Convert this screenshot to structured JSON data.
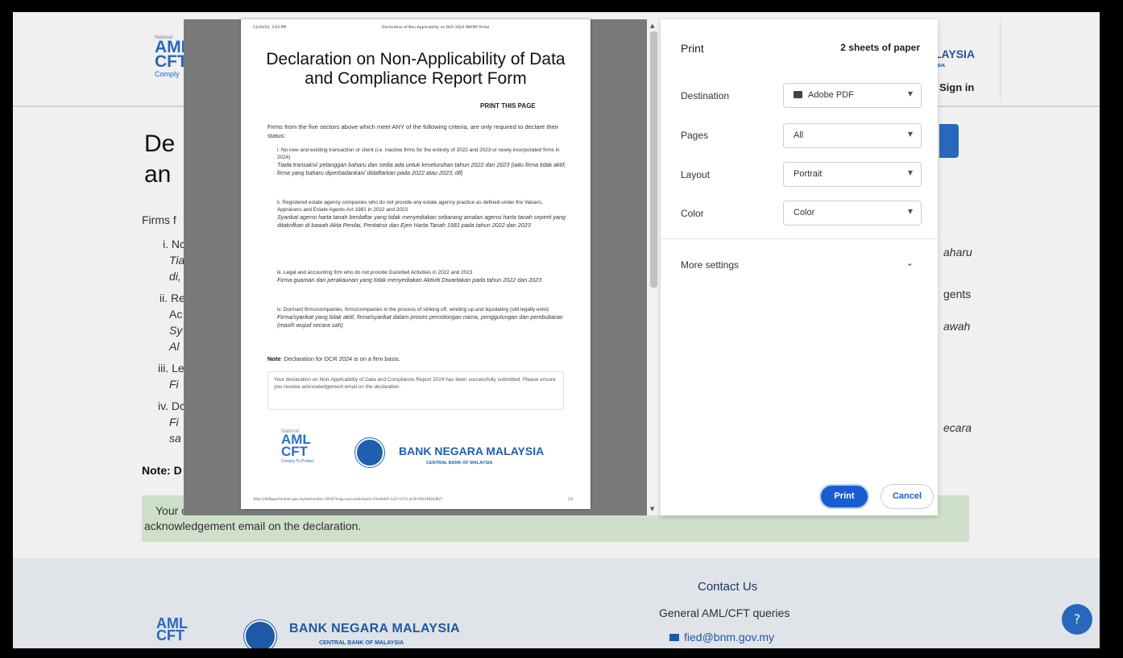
{
  "site": {
    "header": {
      "logo_small": "National",
      "logo_line1": "AML",
      "logo_line2": "CFT",
      "logo_tag": "Comply",
      "brand": "LAYSIA",
      "brand_sub": "YSIA",
      "signin": "Sign in"
    },
    "title": "De\nan",
    "firms": "Firms f",
    "items": [
      {
        "a": "i. Nc",
        "b": "Tia",
        "c": "di,"
      },
      {
        "a": "ii. Re",
        "b": "Ac",
        "c": "Sy",
        "d": "Al"
      },
      {
        "a": "iii. Le",
        "b": "Fi"
      },
      {
        "a": "iv. Dc",
        "b": "Fi",
        "c": "sa"
      }
    ],
    "right_fragments": [
      "aharu",
      "gents",
      "awah",
      "ecara"
    ],
    "note": "Note: D",
    "notice_prefix": "Your c",
    "notice_line2": "acknowledgement email on the declaration.",
    "footer": {
      "contact_title": "Contact Us",
      "general": "General AML/CFT queries",
      "email": "fied@bnm.gov.my",
      "bnm": "BANK NEGARA MALAYSIA",
      "bnm_sub": "CENTRAL BANK OF MALAYSIA",
      "aml": "AML",
      "cft": "CFT"
    }
  },
  "sheet": {
    "hdr_left": "11/20/24, 3:03 PM",
    "hdr_right": "Declaration of Non-Applicability on DCR 2024 DNFBP Portal",
    "title": "Declaration on Non-Applicability of Data and Compliance Report Form",
    "print_page": "PRINT THIS PAGE",
    "intro": "Firms from the five sectors above which meet ANY of the following criteria, are only required to declare their status:",
    "criteria": [
      {
        "en": "i. No new and existing transaction or client (i.e. inactive firms for the entirety of 2022 and 2023 or newly incorporated firms in 2024)",
        "ms": "Tiada transaksi/ pelanggan baharu dan sedia ada untuk keseluruhan tahun 2022 dan 2023 (iaitu firma tidak aktif, firma yang baharu diperbadankan/ didaftarkan pada 2022 atau 2023, dll)"
      },
      {
        "en": "ii. Registered estate agency companies who do not provide any estate agency practice as defined under the Valuers, Appraisers and Estate Agents Act 1981 in 2022 and 2023",
        "ms": "Syarikat agensi harta tanah berdaftar yang tidak menyediakan sebarang amalan agensi harta tanah seperti yang ditakrifkan di bawah Akta Penilai, Pentaksir dan Ejen Harta Tanah 1981 pada tahun 2022 dan 2023"
      },
      {
        "en": "iii. Legal and accounting firm who do not provide Gazetted Activities in 2022 and 2023",
        "ms": "Firma guaman dan perakaunan yang tidak menyediakan Aktiviti Diwartakan pada tahun 2022 dan 2023"
      },
      {
        "en": "iv. Dormant firms/companies, firms/companies in the process of striking off, winding up and liquidating (still legally exist)",
        "ms": "Firma/syarikat yang tidak aktif, firma/syarikat dalam proses pemotongan nama, penggulungan dan pembubaran (masih wujud secara sah)"
      }
    ],
    "note_label": "Note",
    "note_text": ": Declaration for DCR 2024 is on a firm basis.",
    "box_text": "Your declaration on Non-Applicability of Data and Compliance Report 2024 has been successfully submitted. Please ensure you receive acknowledgement email on the declaration.",
    "aml_small": "National",
    "aml": "AML",
    "cft": "CFT",
    "aml_tag": "Comply To Protect",
    "bnm": "BANK NEGARA MALAYSIA",
    "bnm_sub": "CENTRAL BANK OF MALAYSIA",
    "foot_url": "https://dnfbpportal.bnm.gov.my/declaration-2024/?msg=success&ctxpid=55ea0445-1a17-e711-ac20-0022481b3627",
    "foot_page": "1/2"
  },
  "settings": {
    "title": "Print",
    "sheets": "2 sheets of paper",
    "rows": [
      {
        "label": "Destination",
        "value": "Adobe PDF"
      },
      {
        "label": "Pages",
        "value": "All"
      },
      {
        "label": "Layout",
        "value": "Portrait"
      },
      {
        "label": "Color",
        "value": "Color"
      }
    ],
    "more_settings": "More settings",
    "print_btn": "Print",
    "cancel_btn": "Cancel"
  },
  "colors": {
    "accent": "#1a5dd1",
    "brand": "#1f5fb0",
    "notice": "#dcefd7"
  }
}
